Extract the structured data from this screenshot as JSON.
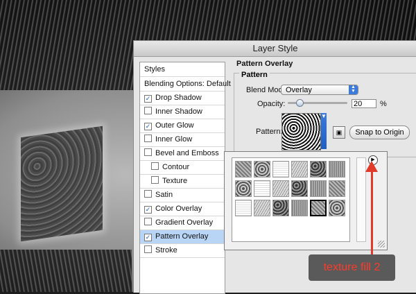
{
  "dialog": {
    "title": "Layer Style"
  },
  "sidebar": {
    "items": [
      {
        "label": "Styles",
        "checkbox": false,
        "checked": false,
        "indent": false,
        "active": false
      },
      {
        "label": "Blending Options: Default",
        "checkbox": false,
        "checked": false,
        "indent": false,
        "active": false
      },
      {
        "label": "Drop Shadow",
        "checkbox": true,
        "checked": true,
        "indent": false,
        "active": false
      },
      {
        "label": "Inner Shadow",
        "checkbox": true,
        "checked": false,
        "indent": false,
        "active": false
      },
      {
        "label": "Outer Glow",
        "checkbox": true,
        "checked": true,
        "indent": false,
        "active": false
      },
      {
        "label": "Inner Glow",
        "checkbox": true,
        "checked": false,
        "indent": false,
        "active": false
      },
      {
        "label": "Bevel and Emboss",
        "checkbox": true,
        "checked": false,
        "indent": false,
        "active": false
      },
      {
        "label": "Contour",
        "checkbox": true,
        "checked": false,
        "indent": true,
        "active": false
      },
      {
        "label": "Texture",
        "checkbox": true,
        "checked": false,
        "indent": true,
        "active": false
      },
      {
        "label": "Satin",
        "checkbox": true,
        "checked": false,
        "indent": false,
        "active": false
      },
      {
        "label": "Color Overlay",
        "checkbox": true,
        "checked": true,
        "indent": false,
        "active": false
      },
      {
        "label": "Gradient Overlay",
        "checkbox": true,
        "checked": false,
        "indent": false,
        "active": false
      },
      {
        "label": "Pattern Overlay",
        "checkbox": true,
        "checked": true,
        "indent": false,
        "active": true
      },
      {
        "label": "Stroke",
        "checkbox": true,
        "checked": false,
        "indent": false,
        "active": false
      }
    ]
  },
  "panel": {
    "section_title": "Pattern Overlay",
    "group_title": "Pattern",
    "blend_mode_label": "Blend Mode:",
    "blend_mode_value": "Overlay",
    "opacity_label": "Opacity:",
    "opacity_value": "20",
    "opacity_unit": "%",
    "opacity_fraction": 0.2,
    "pattern_label": "Pattern:",
    "snap_button": "Snap to Origin"
  },
  "picker": {
    "tile_count": 18,
    "selected_index": 16
  },
  "annotation": {
    "text": "texture fill 2",
    "color": "#e23a2a"
  },
  "icons": {
    "checkmark": "checkmark-icon",
    "select_arrows": "updown-arrows-icon",
    "picker_menu": "play-circle-icon",
    "new_preset": "new-preset-icon"
  }
}
